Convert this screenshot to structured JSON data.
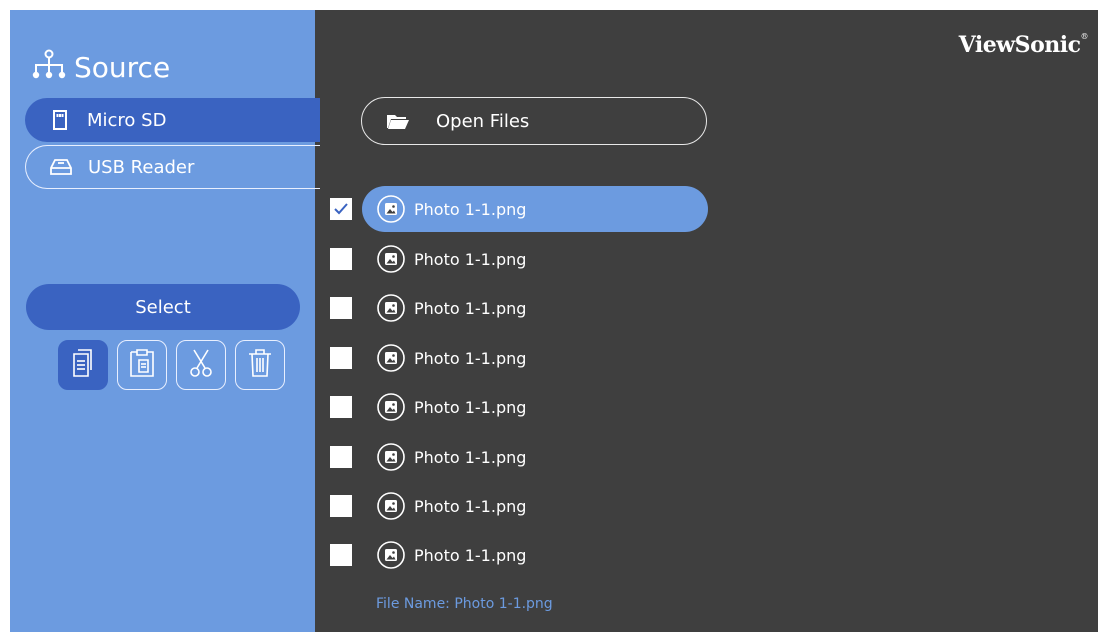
{
  "brand": {
    "name": "ViewSonic",
    "mark": "®"
  },
  "sidebar": {
    "title": "Source",
    "title_icon": "source-tree-icon",
    "items": [
      {
        "label": "Micro SD",
        "icon": "sd-card-icon",
        "active": true
      },
      {
        "label": "USB Reader",
        "icon": "usb-reader-icon",
        "active": false
      }
    ],
    "select_label": "Select",
    "tools": [
      {
        "name": "copy-icon",
        "active": true
      },
      {
        "name": "paste-icon",
        "active": false
      },
      {
        "name": "cut-icon",
        "active": false
      },
      {
        "name": "delete-icon",
        "active": false
      }
    ]
  },
  "main": {
    "open_files_label": "Open Files",
    "open_files_icon": "folder-icon",
    "files": [
      {
        "name": "Photo 1-1.png",
        "checked": true,
        "selected": true
      },
      {
        "name": "Photo 1-1.png",
        "checked": false,
        "selected": false
      },
      {
        "name": "Photo 1-1.png",
        "checked": false,
        "selected": false
      },
      {
        "name": "Photo 1-1.png",
        "checked": false,
        "selected": false
      },
      {
        "name": "Photo 1-1.png",
        "checked": false,
        "selected": false
      },
      {
        "name": "Photo 1-1.png",
        "checked": false,
        "selected": false
      },
      {
        "name": "Photo 1-1.png",
        "checked": false,
        "selected": false
      },
      {
        "name": "Photo 1-1.png",
        "checked": false,
        "selected": false
      }
    ],
    "file_name_label": "File Name: Photo 1-1.png"
  },
  "colors": {
    "sidebar": "#6c9be0",
    "accent": "#3a63c1",
    "background": "#3f3f3f",
    "filename_text": "#6c9be0"
  }
}
